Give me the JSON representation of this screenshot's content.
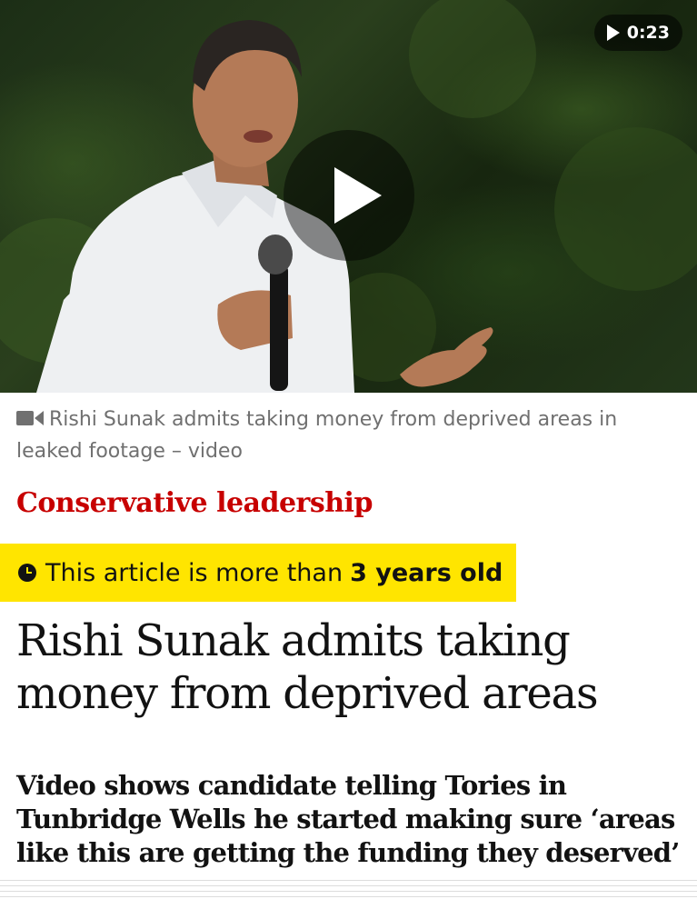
{
  "video": {
    "duration": "0:23",
    "play_icon": "play-icon",
    "caption_icon": "video-camera-icon",
    "caption": "Rishi Sunak admits taking money from deprived areas in leaked footage – video"
  },
  "kicker": "Conservative leadership",
  "age_notice": {
    "icon": "clock-icon",
    "text": "This article is more than",
    "age": "3 years old",
    "background": "#ffe500"
  },
  "headline": "Rishi Sunak admits taking money from deprived areas",
  "standfirst": "Video shows candidate telling Tories in Tunbridge Wells he started making sure ‘areas like this are getting the funding they deserved’",
  "colors": {
    "kicker": "#c70000",
    "text": "#121212",
    "caption": "#707070"
  }
}
